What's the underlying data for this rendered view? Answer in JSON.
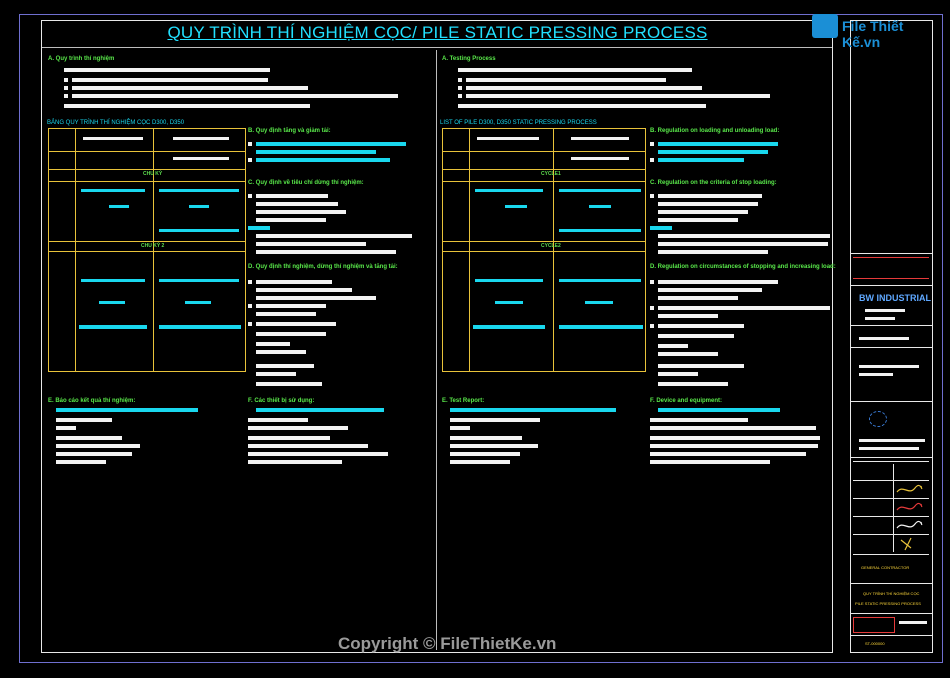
{
  "main_title": "QUY TRÌNH THÍ NGHIỆM CỌC/ PILE STATIC PRESSING PROCESS",
  "left": {
    "h_a": "A. Quy trình thí nghiệm",
    "table_caption": "BẢNG QUY TRÌNH THÍ NGHIỆM CỌC D300, D350",
    "row_cycle1": "CHU KỲ",
    "row_cycle2": "CHU KỲ 2",
    "h_b": "B. Quy định tăng và giảm tải:",
    "h_c": "C. Quy định về tiêu chí dừng thí nghiệm:",
    "h_d": "D. Quy định thí nghiệm, dừng thí nghiệm và tăng tải:",
    "h_e": "E. Báo cáo kết quả thí nghiệm:",
    "h_f": "F. Các thiết bị sử dụng:"
  },
  "right": {
    "h_a": "A. Testing Process",
    "table_caption": "LIST OF PILE D300, D350 STATIC PRESSING PROCESS",
    "row_cycle1": "CYCLE1",
    "row_cycle2": "CYCLE2",
    "h_b": "B. Regulation on loading and unloading load:",
    "h_c": "C. Regulation on the criteria of stop loading:",
    "h_d": "D. Regulation on circumstances of stopping and increasing load:",
    "h_e": "E. Test Report:",
    "h_f": "F. Device and equipment:"
  },
  "titleblock": {
    "company": "BW INDUSTRIAL",
    "drawing_name": "QUY TRÌNH THÍ NGHIỆM CỌC",
    "drawing_name_en": "PILE STATIC PRESSING PROCESS",
    "stamp": "GENERAL CONTRACTOR",
    "drawing_no": "ST-000000"
  },
  "watermark": {
    "brand": "File Thiết Kế.vn",
    "copyright": "Copyright © FileThietKe.vn"
  }
}
